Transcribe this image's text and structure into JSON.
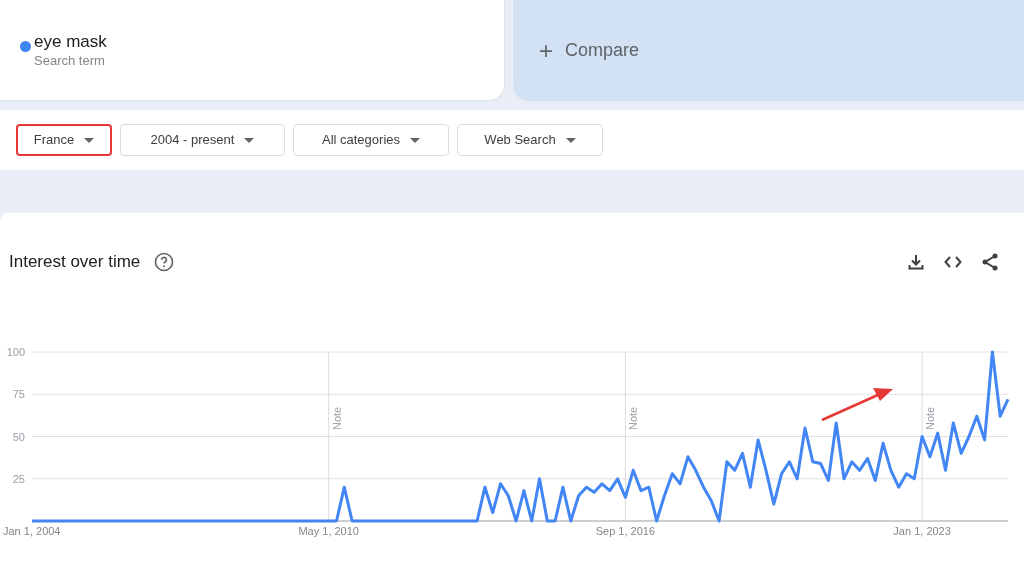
{
  "search_terms": [
    {
      "term": "eye mask",
      "subtitle": "Search term",
      "color": "#4285f4"
    }
  ],
  "compare": {
    "label": "Compare",
    "icon": "+"
  },
  "filters": [
    {
      "label": "France",
      "highlighted": true
    },
    {
      "label": "2004 - present",
      "highlighted": false
    },
    {
      "label": "All categories",
      "highlighted": false
    },
    {
      "label": "Web Search",
      "highlighted": false
    }
  ],
  "interest_over_time": {
    "title": "Interest over time",
    "annotation_arrow": true,
    "chart_data": {
      "type": "line",
      "grid": true,
      "ylim": [
        0,
        100
      ],
      "yticks": [
        25,
        50,
        75,
        100
      ],
      "annotations": [
        "Note",
        "Note",
        "Note"
      ],
      "categories": [
        "Jan 1, 2004",
        null,
        null,
        null,
        null,
        null,
        null,
        null,
        null,
        null,
        null,
        null,
        null,
        null,
        null,
        null,
        null,
        null,
        null,
        null,
        null,
        null,
        null,
        null,
        null,
        null,
        null,
        null,
        null,
        null,
        null,
        null,
        null,
        null,
        null,
        null,
        null,
        null,
        "May 1, 2010",
        null,
        null,
        null,
        null,
        null,
        null,
        null,
        null,
        null,
        null,
        null,
        null,
        null,
        null,
        null,
        null,
        null,
        null,
        null,
        null,
        null,
        null,
        null,
        null,
        null,
        null,
        null,
        null,
        null,
        null,
        null,
        null,
        null,
        null,
        null,
        null,
        null,
        "Sep 1, 2016",
        null,
        null,
        null,
        null,
        null,
        null,
        null,
        null,
        null,
        null,
        null,
        null,
        null,
        null,
        null,
        null,
        null,
        null,
        null,
        null,
        null,
        null,
        null,
        null,
        null,
        null,
        null,
        null,
        null,
        null,
        null,
        null,
        null,
        null,
        null,
        null,
        null,
        "Jan 1, 2023",
        null,
        null,
        null,
        null,
        null,
        null,
        null,
        null,
        null,
        null,
        null
      ],
      "series": [
        {
          "color": "#4285f4",
          "values": [
            0,
            0,
            0,
            0,
            0,
            0,
            0,
            0,
            0,
            0,
            0,
            0,
            0,
            0,
            0,
            0,
            0,
            0,
            0,
            0,
            0,
            0,
            0,
            0,
            0,
            0,
            0,
            0,
            0,
            0,
            0,
            0,
            0,
            0,
            0,
            0,
            0,
            0,
            0,
            0,
            20,
            0,
            0,
            0,
            0,
            0,
            0,
            0,
            0,
            0,
            0,
            0,
            0,
            0,
            0,
            0,
            0,
            0,
            20,
            5,
            22,
            15,
            0,
            18,
            0,
            25,
            0,
            0,
            20,
            0,
            15,
            20,
            17,
            22,
            18,
            25,
            14,
            30,
            18,
            20,
            0,
            15,
            28,
            22,
            38,
            30,
            20,
            12,
            0,
            35,
            30,
            40,
            20,
            48,
            30,
            10,
            28,
            35,
            25,
            55,
            35,
            34,
            24,
            58,
            25,
            35,
            30,
            37,
            24,
            46,
            30,
            20,
            28,
            25,
            50,
            38,
            52,
            30,
            58,
            40,
            50,
            62,
            48,
            100,
            62,
            72
          ]
        }
      ]
    }
  }
}
